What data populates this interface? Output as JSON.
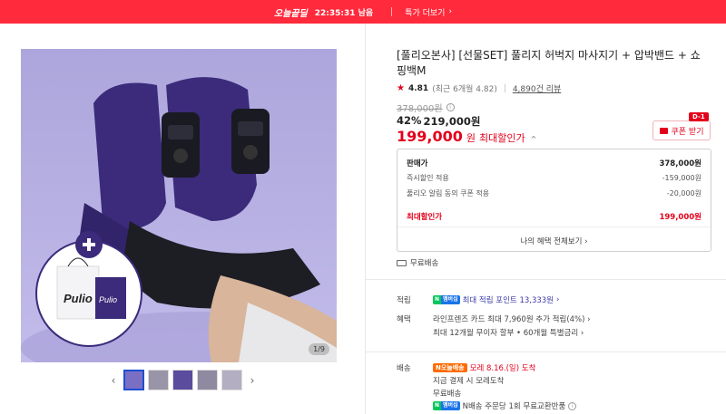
{
  "banner": {
    "tag": "오늘끝딜",
    "time": "22:35:31 남음",
    "link": "특가 더보기"
  },
  "gallery": {
    "counter": "1/9",
    "prev_icon": "chevron-left-icon",
    "next_icon": "chevron-right-icon",
    "thumbnails": 5,
    "bag_brand": "Pulio"
  },
  "product": {
    "title": "[풀리오본사] [선물SET] 풀리지 허벅지 마사지기 + 압박밴드 + 쇼핑백M",
    "rating": "4.81",
    "rating_recent": "(최근 6개월 4.82",
    "review_count": "4,890건 리뷰",
    "original_price": "378,000원",
    "discount_pct": "42%",
    "sale_price": "219,000원",
    "max_price": "199,000",
    "max_price_unit": "원",
    "max_label": "최대할인가",
    "coupon_label": "쿠폰 받기",
    "dday": "D-1"
  },
  "price_box": {
    "head_label": "판매가",
    "head_value": "378,000원",
    "rows": [
      {
        "label": "즉시할인 적용",
        "value": "-159,000원"
      },
      {
        "label": "풀리오 알림 동의 쿠폰 적용",
        "value": "-20,000원"
      }
    ],
    "max_label": "최대할인가",
    "max_value": "199,000원",
    "more_label": "나의 혜택 전체보기"
  },
  "shipping_free": "무료배송",
  "points": {
    "label": "적립",
    "badge_n": "N",
    "badge_m": "멤버십",
    "text": "최대 적립 포인트 13,333원"
  },
  "benefits": {
    "label": "혜택",
    "line1": "라인프렌즈 카드 최대 7,960원 추가 적립(4%)",
    "line2": "최대 12개월 무이자 할부 • 60개월 특별금리"
  },
  "delivery": {
    "label": "배송",
    "today_badge": "N오늘배송",
    "date": "모레 8.16.(일) 도착",
    "line2": "지금 결제 시 모레도착",
    "line3": "무료배송",
    "line4": "N배송 주문당 1회 무료교환반품"
  },
  "colors": {
    "accent_red": "#e3001b",
    "banner_red": "#ff2a3c",
    "product_purple": "#3b2b7a"
  }
}
